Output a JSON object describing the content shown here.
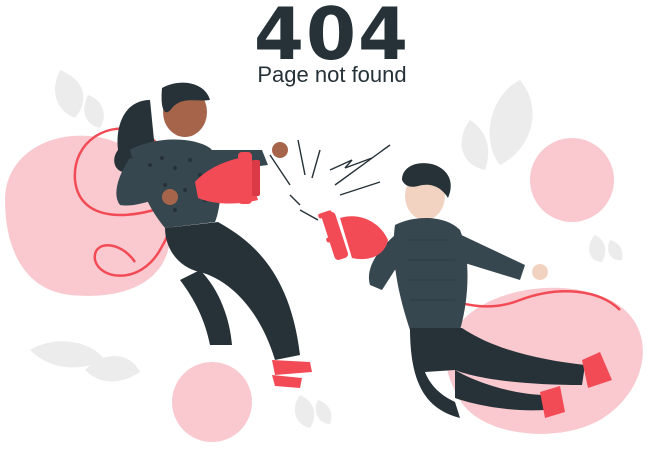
{
  "error": {
    "code": "404",
    "message": "Page not found"
  },
  "illustration": {
    "subject": "two people holding a disconnected power plug",
    "colors": {
      "accent_pink": "#f9c9cf",
      "plug_red": "#f24b56",
      "dark": "#263238",
      "sweater": "#37474f",
      "leaf_gray": "#e6e6e6",
      "skin_dark": "#a6654a",
      "skin_light": "#f2d3c2"
    }
  }
}
